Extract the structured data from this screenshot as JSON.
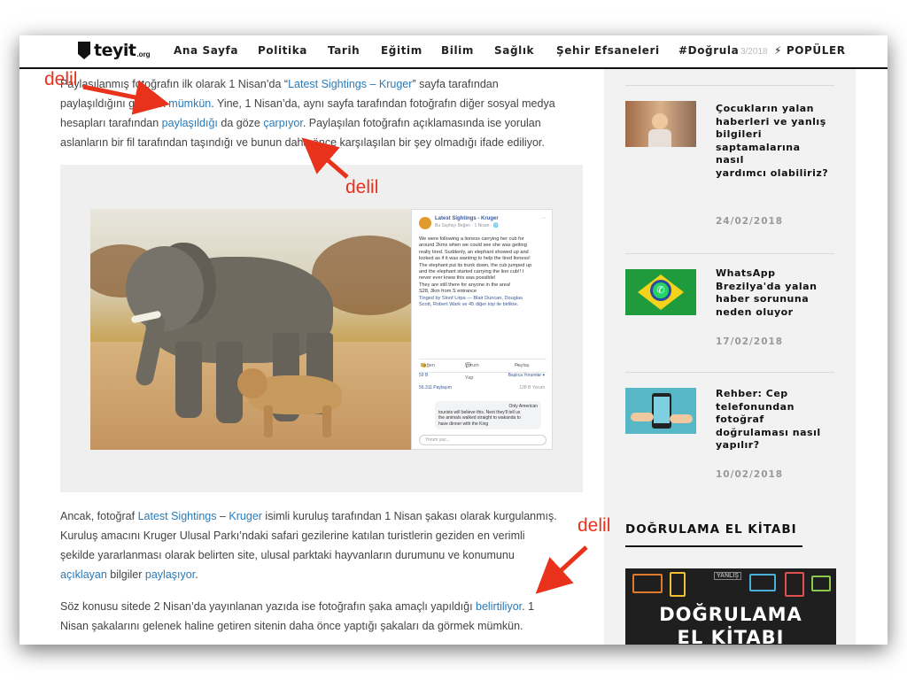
{
  "header": {
    "logo_text": "teyit",
    "logo_sub": ".org",
    "nav": [
      "Ana Sayfa",
      "Politika",
      "Tarih",
      "Eğitim",
      "Bilim",
      "Sağlık",
      "Şehir Efsaneleri",
      "#Doğrula"
    ],
    "popular_label": "POPÜLER",
    "ghost_date": "3/2018"
  },
  "article": {
    "p1": {
      "t1": "Paylaşılanmış fotoğrafın ilk olarak 1 Nisan’da “",
      "link1": "Latest Sightings – Kruger",
      "t2": "” sayfa tarafından",
      "t3": "paylaşıldığını görmek ",
      "link2": "mümkün",
      "t4": ". Yine, 1 Nisan’da, aynı sayfa tarafından fotoğrafın diğer sosyal medya",
      "t5": "hesapları tarafından ",
      "link3": "paylaşıldığı",
      "t6": " da göze ",
      "link4": "çarpıyor",
      "t7": ". Paylaşılan fotoğrafın açıklamasında ise yorulan",
      "t8": "aslanların bir fil tarafından taşındığı ve bunun daha önce karşılaşılan bir şey olmadığı ifade ediliyor."
    },
    "p2": {
      "t1": "Ancak, fotoğraf ",
      "link1": "Latest Sightings",
      "t2": " – ",
      "link2": "Kruger",
      "t3": " isimli kuruluş tarafından 1 Nisan şakası olarak kurgulanmış.",
      "t4": "Kuruluş amacını Kruger Ulusal Parkı’ndaki safari gezilerine katılan turistlerin geziden en verimli",
      "t5": "şekilde yararlanması olarak belirten site, ulusal parktaki hayvanların durumunu ve konumunu",
      "link3": "açıklayan",
      "t6": " bilgiler ",
      "link4": "paylaşıyor",
      "t7": "."
    },
    "p3": {
      "t1": "Söz konusu sitede 2 Nisan’da yayınlanan yazıda ise fotoğrafın şaka amaçlı yapıldığı ",
      "link1": "belirtiliyor",
      "t2": ". 1",
      "t3": "Nisan şakalarını gelenek haline getiren sitenin daha önce yaptığı şakaları da görmek mümkün."
    }
  },
  "fbpost": {
    "page_name": "Latest Sightings - Kruger",
    "meta": "Bu Sayfayı Beğen · 1 Nisan · 🌐",
    "dots": "···",
    "lines": [
      "We were following a lioness carrying her cub for",
      "around 2kms when we could see she was getting",
      "really tired. Suddenly, an elephant showed up and",
      "looked as if it was wanting to help the tired lioness!",
      "The elephant put its trunk down, the cub jumped up",
      "and the elephant started carrying the lion cub!! I",
      "never ever knew this was possible!",
      "They are still there for anyone in the area!",
      "S28, 3km from S entrance",
      "Tinged by Sloof Lirpa — Blair Duncan, Douglas",
      "Scott, Robert Wark ve 45 diğer kişi ile birlikte."
    ],
    "like": "Beğen",
    "comment": "Yorum Yap",
    "share": "Paylaş",
    "reactions": "59 B",
    "sort": "Başlıca Yorumlar ▾",
    "shares": "56.311 Paylaşım",
    "comment_count": "128 B Yorum",
    "comment_lines": [
      "Only American",
      "tourists will believe this. Next they'll tell us",
      "the animals walked straight to wakanda to",
      "have dinner with the King"
    ],
    "input_placeholder": "Yorum yaz..."
  },
  "sidebar": {
    "items": [
      {
        "title_lines": [
          "Çocukların yalan",
          "haberleri ve yanlış",
          "bilgileri",
          "saptamalarına nasıl",
          "yardımcı olabiliriz?"
        ],
        "date": "24/02/2018"
      },
      {
        "title_lines": [
          "WhatsApp",
          "Brezilya'da yalan",
          "haber sorununa",
          "neden oluyor"
        ],
        "date": "17/02/2018"
      },
      {
        "title_lines": [
          "Rehber: Cep",
          "telefonundan",
          "fotoğraf",
          "doğrulaması nasıl",
          "yapılır?"
        ],
        "date": "10/02/2018"
      }
    ],
    "heading": "DOĞRULAMA EL KİTABI",
    "book_line1": "DOĞRULAMA",
    "book_line2": "EL KİTABI",
    "book_badge": "YANLIŞ"
  },
  "annotations": {
    "label": "delil"
  },
  "colors": {
    "link": "#2a7ab8",
    "annotation": "#e8321c",
    "sidebar_bg": "#f2f2f2"
  }
}
